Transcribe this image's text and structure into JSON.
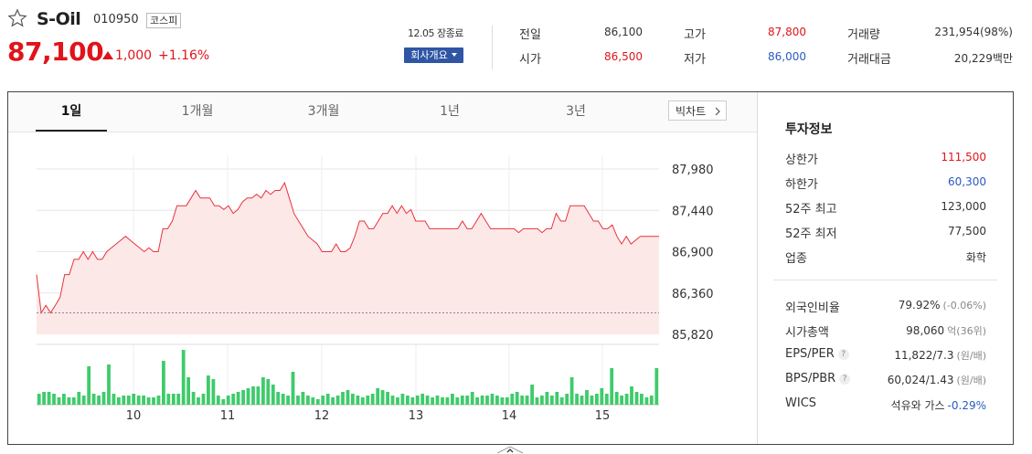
{
  "stock": {
    "name": "S-Oil",
    "code": "010950",
    "market": "코스피",
    "price": "87,100",
    "change": "1,000",
    "change_pct": "+1.16%",
    "date_status": "12.05 장종료",
    "company_button": "회사개요"
  },
  "summary": [
    {
      "label": "전일",
      "value": "86,100",
      "tone": "neutral"
    },
    {
      "label": "시가",
      "value": "86,500",
      "tone": "up"
    },
    {
      "label": "고가",
      "value": "87,800",
      "tone": "up"
    },
    {
      "label": "저가",
      "value": "86,000",
      "tone": "down"
    },
    {
      "label": "거래량",
      "value": "231,954(98%)",
      "tone": "neutral"
    },
    {
      "label": "거래대금",
      "value": "20,229백만",
      "tone": "neutral"
    }
  ],
  "tabs": [
    "1일",
    "1개월",
    "3개월",
    "1년",
    "3년"
  ],
  "active_tab": "1일",
  "big_chart": "빅차트",
  "info": {
    "title": "투자정보",
    "rows1": [
      {
        "label": "상한가",
        "value": "111,500",
        "tone": "up"
      },
      {
        "label": "하한가",
        "value": "60,300",
        "tone": "down"
      },
      {
        "label": "52주 최고",
        "value": "123,000",
        "tone": "neutral"
      },
      {
        "label": "52주 최저",
        "value": "77,500",
        "tone": "neutral"
      },
      {
        "label": "업종",
        "value": "화학",
        "tone": "neutral"
      }
    ],
    "rows2": [
      {
        "label": "외국인비율",
        "value": "79.92%",
        "sub": "(-0.06%)"
      },
      {
        "label": "시가총액",
        "value": "98,060",
        "sub": "억(36위)"
      },
      {
        "label": "EPS/PER",
        "value": "11,822/7.3",
        "sub": "(원/배)",
        "help": "?"
      },
      {
        "label": "BPS/PBR",
        "value": "60,024/1.43",
        "sub": "(원/배)",
        "help": "?"
      },
      {
        "label": "WICS",
        "value": "석유와 가스",
        "sub": "-0.29%"
      }
    ]
  },
  "colors": {
    "up": "#e0141a",
    "down": "#2a5bbf",
    "line": "#e8323c",
    "fill": "#fde8e8",
    "volume": "#3fcb6b"
  },
  "chart_data": {
    "type": "area",
    "y_ticks": [
      "87,980",
      "87,440",
      "86,900",
      "86,360",
      "85,820"
    ],
    "ylim": [
      85820,
      87980
    ],
    "x_ticks": [
      "10",
      "11",
      "12",
      "13",
      "14",
      "15"
    ],
    "prev_close": 86100,
    "price": [
      86600,
      86100,
      86200,
      86100,
      86200,
      86300,
      86600,
      86600,
      86800,
      86800,
      86900,
      86800,
      86900,
      86800,
      86800,
      86900,
      86950,
      87000,
      87050,
      87100,
      87050,
      87000,
      86950,
      86900,
      86950,
      86900,
      86900,
      87200,
      87200,
      87300,
      87500,
      87500,
      87500,
      87600,
      87700,
      87600,
      87600,
      87600,
      87500,
      87500,
      87450,
      87500,
      87400,
      87450,
      87550,
      87600,
      87600,
      87650,
      87600,
      87700,
      87650,
      87700,
      87700,
      87800,
      87600,
      87400,
      87300,
      87200,
      87100,
      87050,
      87000,
      86900,
      86900,
      86900,
      87000,
      86900,
      86900,
      86950,
      87100,
      87300,
      87300,
      87200,
      87200,
      87300,
      87400,
      87400,
      87500,
      87400,
      87500,
      87400,
      87450,
      87300,
      87300,
      87300,
      87200,
      87200,
      87200,
      87200,
      87200,
      87200,
      87200,
      87300,
      87200,
      87200,
      87300,
      87400,
      87300,
      87200,
      87200,
      87200,
      87200,
      87200,
      87200,
      87150,
      87200,
      87200,
      87200,
      87200,
      87150,
      87200,
      87200,
      87400,
      87300,
      87300,
      87500,
      87500,
      87500,
      87500,
      87400,
      87300,
      87300,
      87200,
      87200,
      87250,
      87100,
      87000,
      87100,
      87000,
      87050,
      87100,
      87100,
      87100,
      87100,
      87100
    ],
    "volume": [
      12,
      14,
      14,
      12,
      8,
      12,
      8,
      8,
      14,
      10,
      42,
      12,
      10,
      14,
      44,
      12,
      8,
      10,
      10,
      12,
      10,
      10,
      8,
      8,
      10,
      48,
      12,
      12,
      12,
      60,
      30,
      14,
      8,
      12,
      32,
      28,
      10,
      6,
      10,
      12,
      14,
      16,
      18,
      20,
      20,
      30,
      28,
      22,
      14,
      12,
      10,
      36,
      10,
      14,
      10,
      8,
      6,
      10,
      12,
      8,
      10,
      14,
      16,
      12,
      10,
      8,
      10,
      12,
      18,
      16,
      14,
      10,
      8,
      12,
      10,
      8,
      10,
      12,
      10,
      8,
      10,
      8,
      8,
      12,
      8,
      10,
      10,
      14,
      8,
      10,
      10,
      12,
      10,
      8,
      8,
      12,
      14,
      10,
      10,
      22,
      8,
      10,
      14,
      10,
      14,
      8,
      12,
      30,
      12,
      10,
      16,
      10,
      12,
      18,
      12,
      40,
      14,
      10,
      12,
      20,
      14,
      12,
      8,
      10,
      40
    ]
  }
}
